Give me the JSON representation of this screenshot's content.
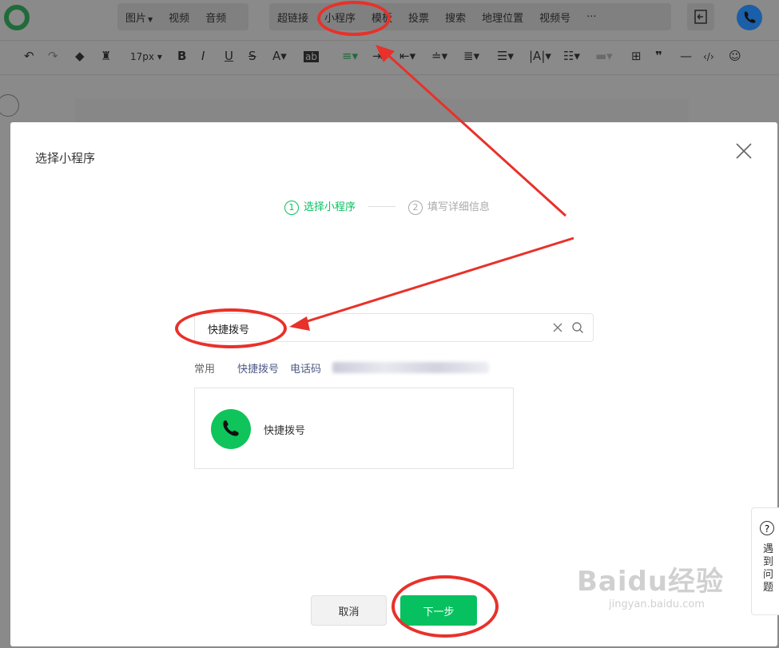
{
  "topbar": {
    "menu_group_1": [
      "图片",
      "视频",
      "音频"
    ],
    "menu_group_2": [
      "超链接",
      "小程序",
      "模板",
      "投票",
      "搜索",
      "地理位置",
      "视频号",
      "···"
    ]
  },
  "toolbar": {
    "font_size": "17px"
  },
  "modal": {
    "title": "选择小程序",
    "steps": [
      {
        "num": "1",
        "label": "选择小程序"
      },
      {
        "num": "2",
        "label": "填写详细信息"
      }
    ],
    "search_value": "快捷拨号",
    "recent_label": "常用",
    "recent_items": [
      "快捷拨号",
      "电话码"
    ],
    "result": {
      "name": "快捷拨号"
    },
    "cancel_label": "取消",
    "next_label": "下一步"
  },
  "help": {
    "text": "遇到问题"
  },
  "watermark": {
    "main": "Baidu经验",
    "sub": "jingyan.baidu.com"
  },
  "colors": {
    "accent_green": "#07c160",
    "annotation_red": "#e8312a",
    "overlay_gray": "#8a8a8a"
  }
}
